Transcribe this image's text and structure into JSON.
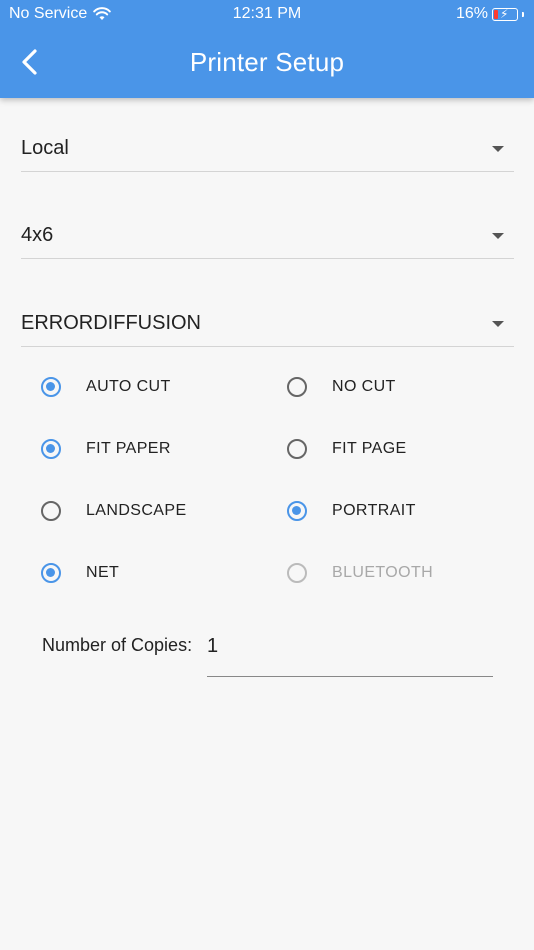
{
  "status_bar": {
    "carrier": "No Service",
    "time": "12:31 PM",
    "battery": "16%",
    "icons": [
      "wifi-icon",
      "battery-charging-icon"
    ]
  },
  "header": {
    "title": "Printer Setup",
    "back_icon": "chevron-left-icon",
    "color": "#4a95e8"
  },
  "dropdowns": {
    "printer_type": "Local",
    "paper_size": "4x6",
    "dithering": "ERRORDIFFUSION"
  },
  "options": {
    "auto_cut": {
      "label": "AUTO CUT",
      "selected": true
    },
    "no_cut": {
      "label": "NO CUT",
      "selected": false
    },
    "fit_paper": {
      "label": "FIT PAPER",
      "selected": true
    },
    "fit_page": {
      "label": "FIT PAGE",
      "selected": false
    },
    "landscape": {
      "label": "LANDSCAPE",
      "selected": false
    },
    "portrait": {
      "label": "PORTRAIT",
      "selected": true
    },
    "net": {
      "label": "NET",
      "selected": true
    },
    "bluetooth": {
      "label": "BLUETOOTH",
      "selected": false,
      "disabled": true
    }
  },
  "copies": {
    "label": "Number of Copies:",
    "value": "1"
  }
}
